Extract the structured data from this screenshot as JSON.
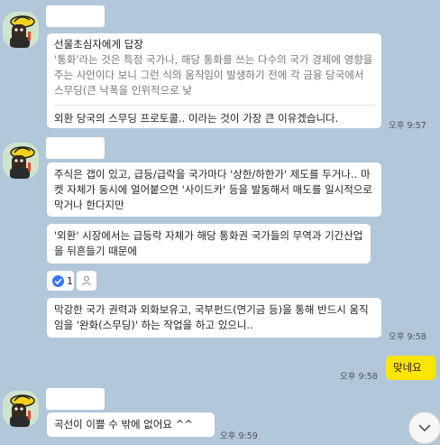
{
  "messages": {
    "group1": {
      "reply_header": "선물초심자에게 답장",
      "reply_quote": "'통화'라는 것은 특정 국가나, 해당 통화를 쓰는 다수의 국가 경제에 영향을 주는 사안이다 보니 그런 식의 움직임이 발생하기 전에 각 금융 당국에서 스무딩(큰 낙폭을 인위적으로 낮",
      "reply_text": "외환 당국의 스무딩 프로토콜.. 이라는 것이 가장 큰 이유겠습니다.",
      "time": "오후 9:57"
    },
    "group2": {
      "msg1": "주식은 갭이 있고, 급등/급락을 국가마다 '상한/하한가' 제도를 두거나.. 마켓 자체가 동시에 얼어붙으면 '사이드카' 등을 발동해서 매도를 일시적으로 막거나 한다지만",
      "msg2": "'외환' 시장에서는 급등락 자체가 해당 통화권 국가들의 무역과 기간산업을 뒤흔들기 때문에",
      "reaction_count": "1",
      "msg3": "막강한 국가 권력과 외화보유고, 국부펀드(연기금 등)을 통해 반드시 움직임을 '완화(스무딩)' 하는 작업을 하고 있으니..",
      "time": "오후 9:58"
    },
    "mine": {
      "text": "맞네요",
      "time": "오후 9:58"
    },
    "group3": {
      "msg1": "곡선이 이쁠 수 밖에 없어요 ^^",
      "time": "오후 9:59"
    }
  },
  "icons": {
    "avatar": "cartoon-character-with-yellow-hat-avatar",
    "reaction_check": "check-circle-icon",
    "reaction_person": "person-icon",
    "scroll": "chevron-down-icon"
  },
  "colors": {
    "background": "#b2c7da",
    "my_bubble": "#fee500",
    "reaction_check": "#3478f6"
  }
}
